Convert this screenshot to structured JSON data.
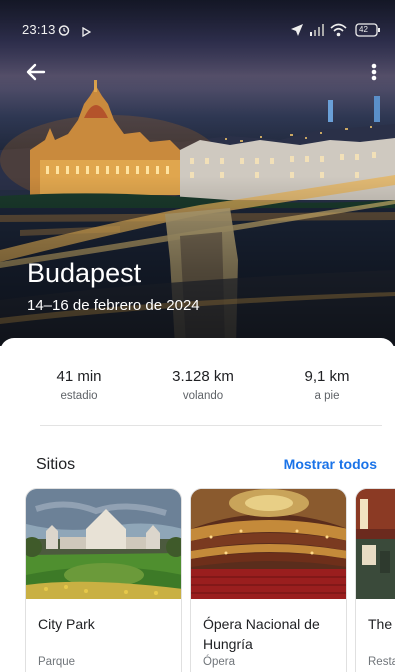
{
  "status_bar": {
    "time": "23:13",
    "battery": "42",
    "icons": [
      "alarm-icon",
      "play-icon",
      "location-arrow-icon",
      "signal-icon",
      "wifi-icon",
      "battery-icon"
    ]
  },
  "header": {
    "back_icon": "arrow-back-icon",
    "menu_icon": "more-vert-icon",
    "title": "Budapest",
    "dates": "14–16 de febrero de 2024"
  },
  "stats": [
    {
      "value": "41 min",
      "label": "estadio"
    },
    {
      "value": "3.128 km",
      "label": "volando"
    },
    {
      "value": "9,1 km",
      "label": "a pie"
    }
  ],
  "places": {
    "title": "Sitios",
    "show_all": "Mostrar todos",
    "items": [
      {
        "name": "City Park",
        "type": "Parque"
      },
      {
        "name": "Ópera Nacional de Hungría",
        "type": "Ópera"
      },
      {
        "name": "The Rest",
        "type": "Resta"
      }
    ]
  },
  "colors": {
    "accent": "#1a73e8",
    "text_primary": "#202124",
    "text_secondary": "#5f6368"
  }
}
